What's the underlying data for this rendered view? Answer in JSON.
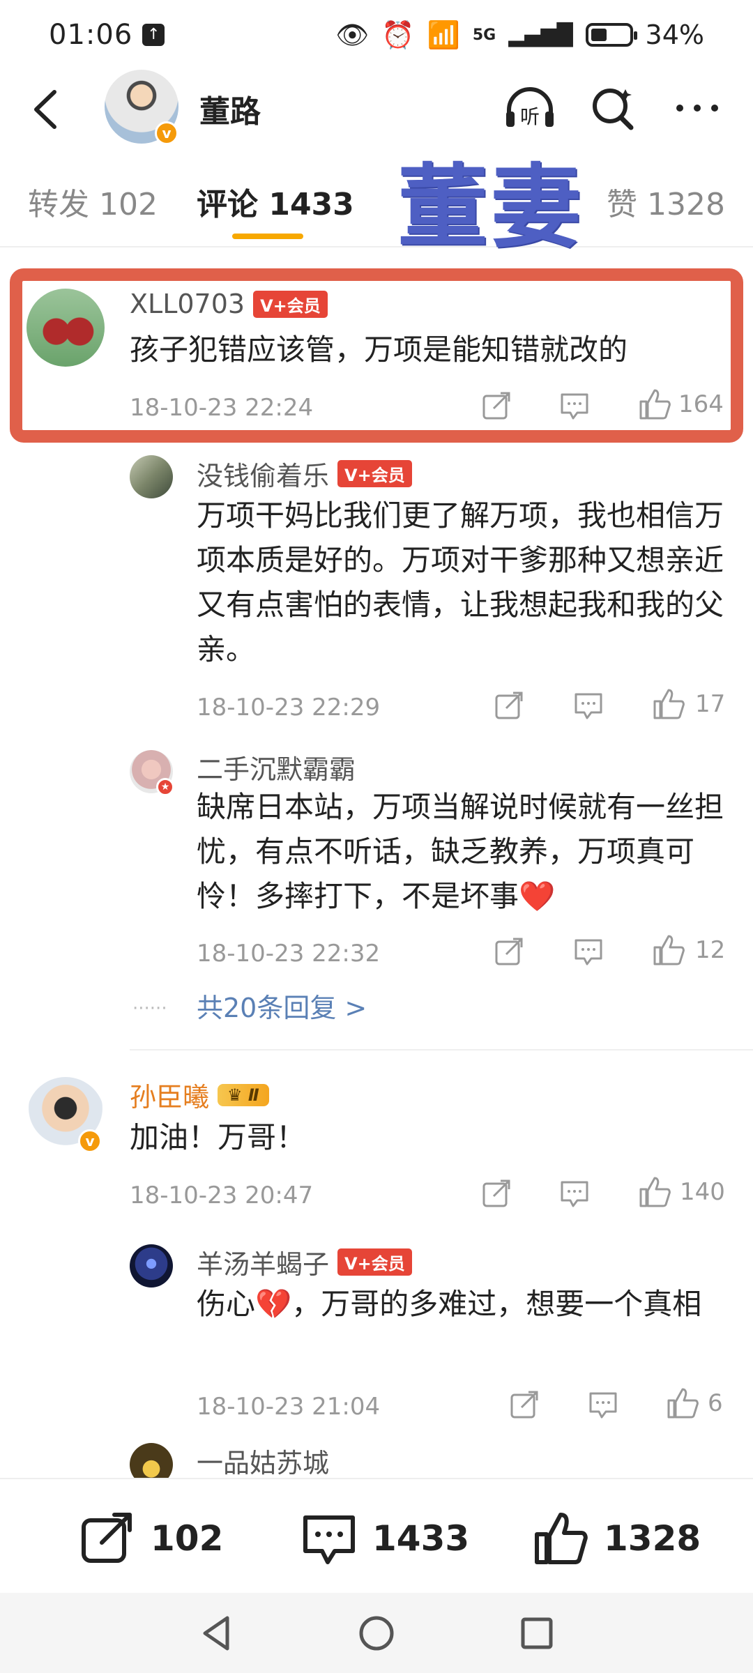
{
  "status_bar": {
    "time": "01:06",
    "signal_label": "5G",
    "battery": "34%"
  },
  "header": {
    "user_name": "董路",
    "listen_label": "听",
    "badge_letter": "v"
  },
  "tabs": {
    "repost_label": "转发",
    "repost_count": "102",
    "comments_label": "评论",
    "comments_count": "1433",
    "likes_label": "赞",
    "likes_count": "1328"
  },
  "overlay_text": "董妻",
  "comments": [
    {
      "user": "XLL0703",
      "tag": "V+会员",
      "text": "孩子犯错应该管，万项是能知错就改的",
      "time": "18-10-23 22:24",
      "likes": "164",
      "replies": [
        {
          "user": "没钱偷着乐",
          "tag": "V+会员",
          "text": "万项干妈比我们更了解万项，我也相信万项本质是好的。万项对干爹那种又想亲近又有点害怕的表情，让我想起我和我的父亲。",
          "time": "18-10-23 22:29",
          "likes": "17"
        },
        {
          "user": "二手沉默霸霸",
          "text": "缺席日本站，万项当解说时候就有一丝担忧，有点不听话，缺乏教养，万项真可怜！多摔打下，不是坏事❤️",
          "time": "18-10-23 22:32",
          "likes": "12"
        }
      ],
      "more_replies": "共20条回复 >"
    },
    {
      "user": "孙臣曦",
      "tag": "Ⅱ",
      "text": "加油！万哥！",
      "time": "18-10-23 20:47",
      "likes": "140",
      "replies": [
        {
          "user": "羊汤羊蝎子",
          "tag": "V+会员",
          "text": "伤心💔，万哥的多难过，想要一个真相",
          "time": "18-10-23 21:04",
          "likes": "6"
        },
        {
          "user": "一品姑苏城"
        }
      ]
    }
  ],
  "bottom_bar": {
    "repost_count": "102",
    "comment_count": "1433",
    "like_count": "1328"
  },
  "colors": {
    "highlight_border": "#e0604a",
    "vip_tag": "#e64537",
    "tab_underline": "#f7a800",
    "link": "#5a80b5",
    "overlay_text": "#4e5fc3"
  },
  "icons": [
    "back-arrow-icon",
    "headphones-icon",
    "search-icon",
    "more-icon",
    "share-icon",
    "comment-icon",
    "like-icon"
  ]
}
